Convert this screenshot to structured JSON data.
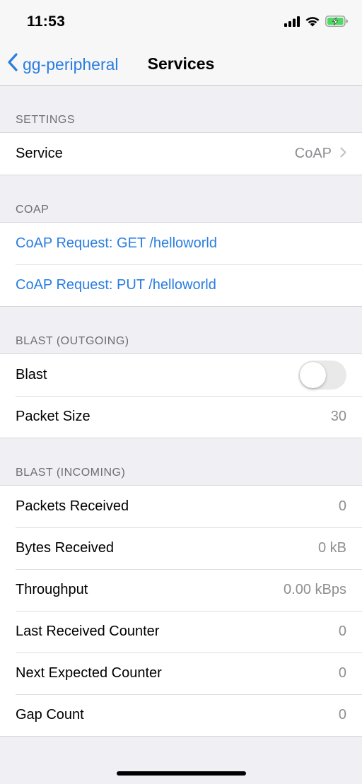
{
  "status_bar": {
    "time": "11:53"
  },
  "nav": {
    "back_label": "gg-peripheral",
    "title": "Services"
  },
  "sections": {
    "settings": {
      "header": "SETTINGS",
      "service_label": "Service",
      "service_value": "CoAP"
    },
    "coap": {
      "header": "COAP",
      "get_label": "CoAP Request: GET /helloworld",
      "put_label": "CoAP Request: PUT /helloworld"
    },
    "blast_outgoing": {
      "header": "BLAST (OUTGOING)",
      "blast_label": "Blast",
      "blast_on": false,
      "packet_size_label": "Packet Size",
      "packet_size_value": "30"
    },
    "blast_incoming": {
      "header": "BLAST (INCOMING)",
      "rows": [
        {
          "label": "Packets Received",
          "value": "0"
        },
        {
          "label": "Bytes Received",
          "value": "0 kB"
        },
        {
          "label": "Throughput",
          "value": "0.00 kBps"
        },
        {
          "label": "Last Received Counter",
          "value": "0"
        },
        {
          "label": "Next Expected Counter",
          "value": "0"
        },
        {
          "label": "Gap Count",
          "value": "0"
        }
      ]
    }
  },
  "colors": {
    "accent": "#2a7de1",
    "background": "#efeff4",
    "secondary_text": "#8e8e93",
    "battery": "#4cd964"
  },
  "icons": [
    "signal-icon",
    "wifi-icon",
    "battery-charging-icon",
    "back-chevron-icon",
    "chevron-right-icon"
  ]
}
